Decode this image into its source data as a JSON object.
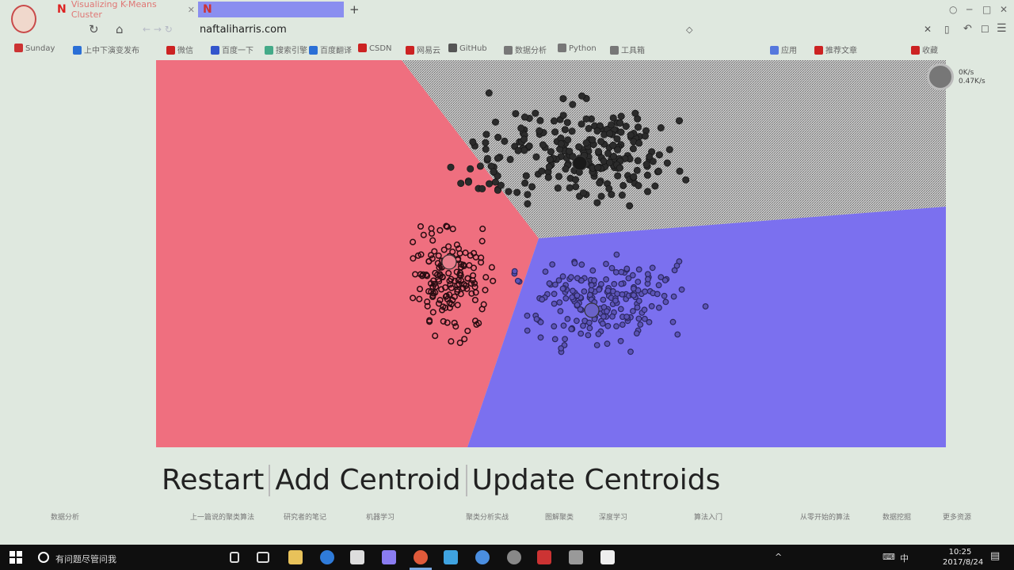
{
  "browser": {
    "tabs": [
      {
        "title": "Visualizing K-Means Cluster",
        "favicon": "N",
        "active": false
      },
      {
        "title": "",
        "favicon": "N",
        "active": true
      }
    ],
    "new_tab": "+",
    "address": "naftaliharris.com",
    "address_prefix": "← → ↻",
    "bookmarks": [
      {
        "label": "Sunday",
        "color": "#cc3333"
      },
      {
        "label": "上中下演变发布",
        "color": "#2b6fd6"
      },
      {
        "label": "微信",
        "color": "#c22"
      },
      {
        "label": "百度一下",
        "color": "#3355cc"
      },
      {
        "label": "搜索引擎",
        "color": "#4a8"
      },
      {
        "label": "百度翻译",
        "color": "#2b6fd6"
      },
      {
        "label": "CSDN",
        "color": "#c22"
      },
      {
        "label": "网易云",
        "color": "#c22"
      },
      {
        "label": "GitHub",
        "color": "#555"
      },
      {
        "label": "数据分析",
        "color": "#777"
      },
      {
        "label": "Python",
        "color": "#777"
      },
      {
        "label": "工具箱",
        "color": "#777"
      },
      {
        "label": "应用",
        "color": "#5577dd"
      },
      {
        "label": "推荐文章",
        "color": "#c22"
      },
      {
        "label": "收藏",
        "color": "#c22"
      }
    ]
  },
  "speed_widget": {
    "up": "0K/s",
    "down": "0.47K/s"
  },
  "controls": {
    "restart": "Restart",
    "add_centroid": "Add Centroid",
    "update_centroids": "Update Centroids"
  },
  "regions": {
    "red": "#ef6f7f",
    "gray": "#a8a8a8",
    "blue": "#7b70ef"
  },
  "bottom_links": [
    "数据分析",
    "上一篇说的聚类算法",
    "研究者的笔记",
    "机器学习",
    "聚类分析实战",
    "图解聚类",
    "深度学习",
    "算法入门",
    "从零开始的算法",
    "数据挖掘",
    "更多资源"
  ],
  "taskbar": {
    "search_placeholder": "有问题尽管问我",
    "time": "10:25",
    "date": "2017/8/24",
    "ime": "中"
  }
}
